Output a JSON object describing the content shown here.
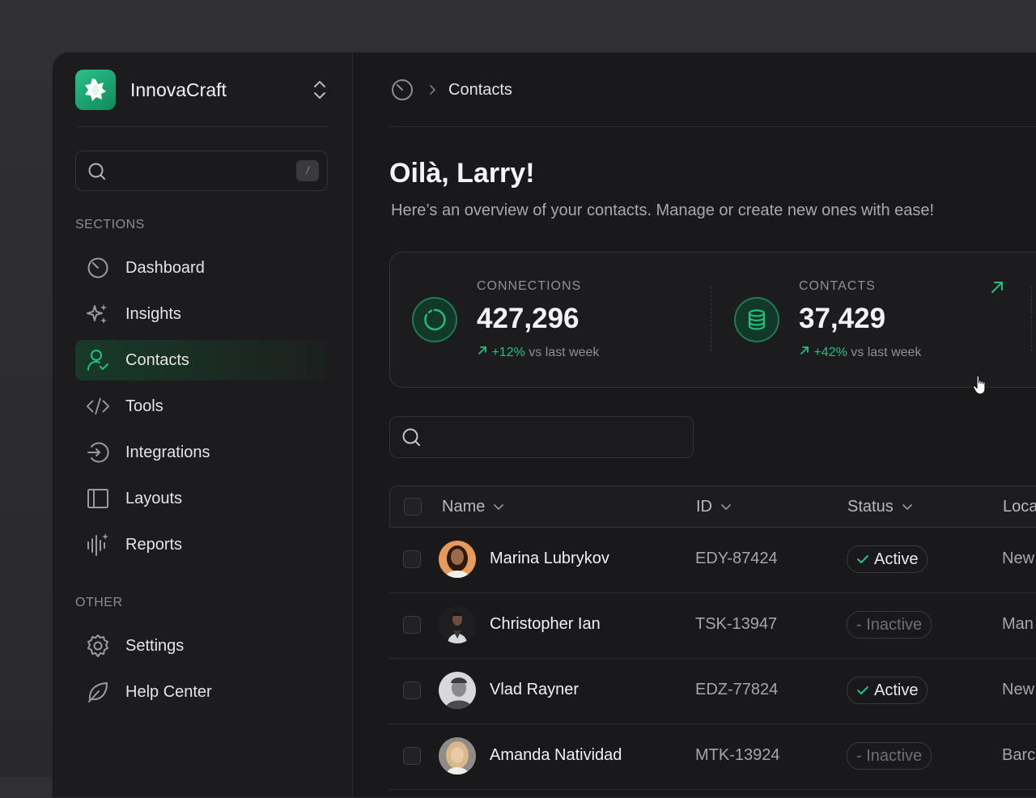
{
  "brand": {
    "name": "InnovaCraft"
  },
  "sidebar": {
    "search": {
      "placeholder": "",
      "shortcut": "/"
    },
    "sections_label": "SECTIONS",
    "items": [
      {
        "label": "Dashboard",
        "icon": "dashboard-gauge-icon"
      },
      {
        "label": "Insights",
        "icon": "sparkles-icon"
      },
      {
        "label": "Contacts",
        "icon": "user-check-icon",
        "active": true
      },
      {
        "label": "Tools",
        "icon": "code-icon"
      },
      {
        "label": "Integrations",
        "icon": "sign-in-icon"
      },
      {
        "label": "Layouts",
        "icon": "layout-panel-icon"
      },
      {
        "label": "Reports",
        "icon": "audio-bars-icon"
      }
    ],
    "other_label": "OTHER",
    "other_items": [
      {
        "label": "Settings",
        "icon": "gear-icon"
      },
      {
        "label": "Help Center",
        "icon": "leaf-icon"
      }
    ]
  },
  "header": {
    "breadcrumb": "Contacts"
  },
  "main": {
    "greeting": "Oilà, Larry!",
    "subtitle": "Here’s an overview of your contacts. Manage or create new ones with ease!",
    "stats": [
      {
        "label": "CONNECTIONS",
        "value": "427,296",
        "delta": "+12%",
        "delta_suffix": "vs last week"
      },
      {
        "label": "CONTACTS",
        "value": "37,429",
        "delta": "+42%",
        "delta_suffix": "vs last week"
      }
    ],
    "table_search": {
      "placeholder": ""
    },
    "table": {
      "columns": [
        "Name",
        "ID",
        "Status",
        "Loca"
      ],
      "rows": [
        {
          "name": "Marina Lubrykov",
          "id": "EDY-87424",
          "status": "Active",
          "location": "New"
        },
        {
          "name": "Christopher Ian",
          "id": "TSK-13947",
          "status": "- Inactive",
          "location": "Man"
        },
        {
          "name": "Vlad Rayner",
          "id": "EDZ-77824",
          "status": "Active",
          "location": "New"
        },
        {
          "name": "Amanda Natividad",
          "id": "MTK-13924",
          "status": "- Inactive",
          "location": "Barc"
        }
      ]
    }
  },
  "colors": {
    "accent": "#23c07d",
    "background": "#19191b",
    "sidebar": "#1c1c1e"
  }
}
